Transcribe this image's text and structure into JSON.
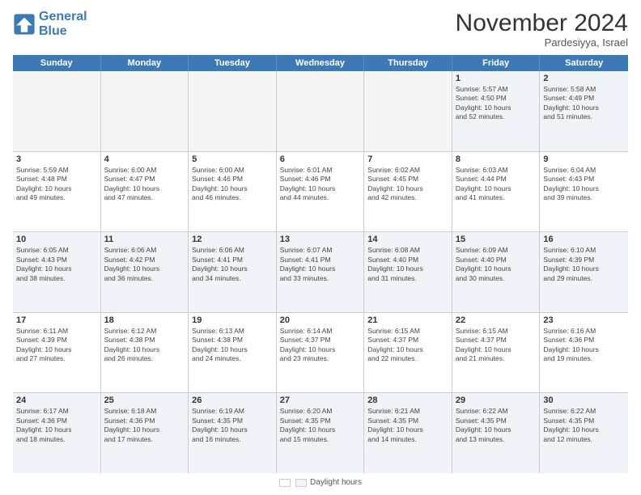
{
  "logo": {
    "line1": "General",
    "line2": "Blue"
  },
  "title": "November 2024",
  "location": "Pardesiyya, Israel",
  "days_of_week": [
    "Sunday",
    "Monday",
    "Tuesday",
    "Wednesday",
    "Thursday",
    "Friday",
    "Saturday"
  ],
  "footer": {
    "daylight_label": "Daylight hours"
  },
  "weeks": [
    [
      {
        "day": "",
        "info": ""
      },
      {
        "day": "",
        "info": ""
      },
      {
        "day": "",
        "info": ""
      },
      {
        "day": "",
        "info": ""
      },
      {
        "day": "",
        "info": ""
      },
      {
        "day": "1",
        "info": "Sunrise: 5:57 AM\nSunset: 4:50 PM\nDaylight: 10 hours\nand 52 minutes."
      },
      {
        "day": "2",
        "info": "Sunrise: 5:58 AM\nSunset: 4:49 PM\nDaylight: 10 hours\nand 51 minutes."
      }
    ],
    [
      {
        "day": "3",
        "info": "Sunrise: 5:59 AM\nSunset: 4:48 PM\nDaylight: 10 hours\nand 49 minutes."
      },
      {
        "day": "4",
        "info": "Sunrise: 6:00 AM\nSunset: 4:47 PM\nDaylight: 10 hours\nand 47 minutes."
      },
      {
        "day": "5",
        "info": "Sunrise: 6:00 AM\nSunset: 4:46 PM\nDaylight: 10 hours\nand 46 minutes."
      },
      {
        "day": "6",
        "info": "Sunrise: 6:01 AM\nSunset: 4:46 PM\nDaylight: 10 hours\nand 44 minutes."
      },
      {
        "day": "7",
        "info": "Sunrise: 6:02 AM\nSunset: 4:45 PM\nDaylight: 10 hours\nand 42 minutes."
      },
      {
        "day": "8",
        "info": "Sunrise: 6:03 AM\nSunset: 4:44 PM\nDaylight: 10 hours\nand 41 minutes."
      },
      {
        "day": "9",
        "info": "Sunrise: 6:04 AM\nSunset: 4:43 PM\nDaylight: 10 hours\nand 39 minutes."
      }
    ],
    [
      {
        "day": "10",
        "info": "Sunrise: 6:05 AM\nSunset: 4:43 PM\nDaylight: 10 hours\nand 38 minutes."
      },
      {
        "day": "11",
        "info": "Sunrise: 6:06 AM\nSunset: 4:42 PM\nDaylight: 10 hours\nand 36 minutes."
      },
      {
        "day": "12",
        "info": "Sunrise: 6:06 AM\nSunset: 4:41 PM\nDaylight: 10 hours\nand 34 minutes."
      },
      {
        "day": "13",
        "info": "Sunrise: 6:07 AM\nSunset: 4:41 PM\nDaylight: 10 hours\nand 33 minutes."
      },
      {
        "day": "14",
        "info": "Sunrise: 6:08 AM\nSunset: 4:40 PM\nDaylight: 10 hours\nand 31 minutes."
      },
      {
        "day": "15",
        "info": "Sunrise: 6:09 AM\nSunset: 4:40 PM\nDaylight: 10 hours\nand 30 minutes."
      },
      {
        "day": "16",
        "info": "Sunrise: 6:10 AM\nSunset: 4:39 PM\nDaylight: 10 hours\nand 29 minutes."
      }
    ],
    [
      {
        "day": "17",
        "info": "Sunrise: 6:11 AM\nSunset: 4:39 PM\nDaylight: 10 hours\nand 27 minutes."
      },
      {
        "day": "18",
        "info": "Sunrise: 6:12 AM\nSunset: 4:38 PM\nDaylight: 10 hours\nand 26 minutes."
      },
      {
        "day": "19",
        "info": "Sunrise: 6:13 AM\nSunset: 4:38 PM\nDaylight: 10 hours\nand 24 minutes."
      },
      {
        "day": "20",
        "info": "Sunrise: 6:14 AM\nSunset: 4:37 PM\nDaylight: 10 hours\nand 23 minutes."
      },
      {
        "day": "21",
        "info": "Sunrise: 6:15 AM\nSunset: 4:37 PM\nDaylight: 10 hours\nand 22 minutes."
      },
      {
        "day": "22",
        "info": "Sunrise: 6:15 AM\nSunset: 4:37 PM\nDaylight: 10 hours\nand 21 minutes."
      },
      {
        "day": "23",
        "info": "Sunrise: 6:16 AM\nSunset: 4:36 PM\nDaylight: 10 hours\nand 19 minutes."
      }
    ],
    [
      {
        "day": "24",
        "info": "Sunrise: 6:17 AM\nSunset: 4:36 PM\nDaylight: 10 hours\nand 18 minutes."
      },
      {
        "day": "25",
        "info": "Sunrise: 6:18 AM\nSunset: 4:36 PM\nDaylight: 10 hours\nand 17 minutes."
      },
      {
        "day": "26",
        "info": "Sunrise: 6:19 AM\nSunset: 4:35 PM\nDaylight: 10 hours\nand 16 minutes."
      },
      {
        "day": "27",
        "info": "Sunrise: 6:20 AM\nSunset: 4:35 PM\nDaylight: 10 hours\nand 15 minutes."
      },
      {
        "day": "28",
        "info": "Sunrise: 6:21 AM\nSunset: 4:35 PM\nDaylight: 10 hours\nand 14 minutes."
      },
      {
        "day": "29",
        "info": "Sunrise: 6:22 AM\nSunset: 4:35 PM\nDaylight: 10 hours\nand 13 minutes."
      },
      {
        "day": "30",
        "info": "Sunrise: 6:22 AM\nSunset: 4:35 PM\nDaylight: 10 hours\nand 12 minutes."
      }
    ]
  ]
}
